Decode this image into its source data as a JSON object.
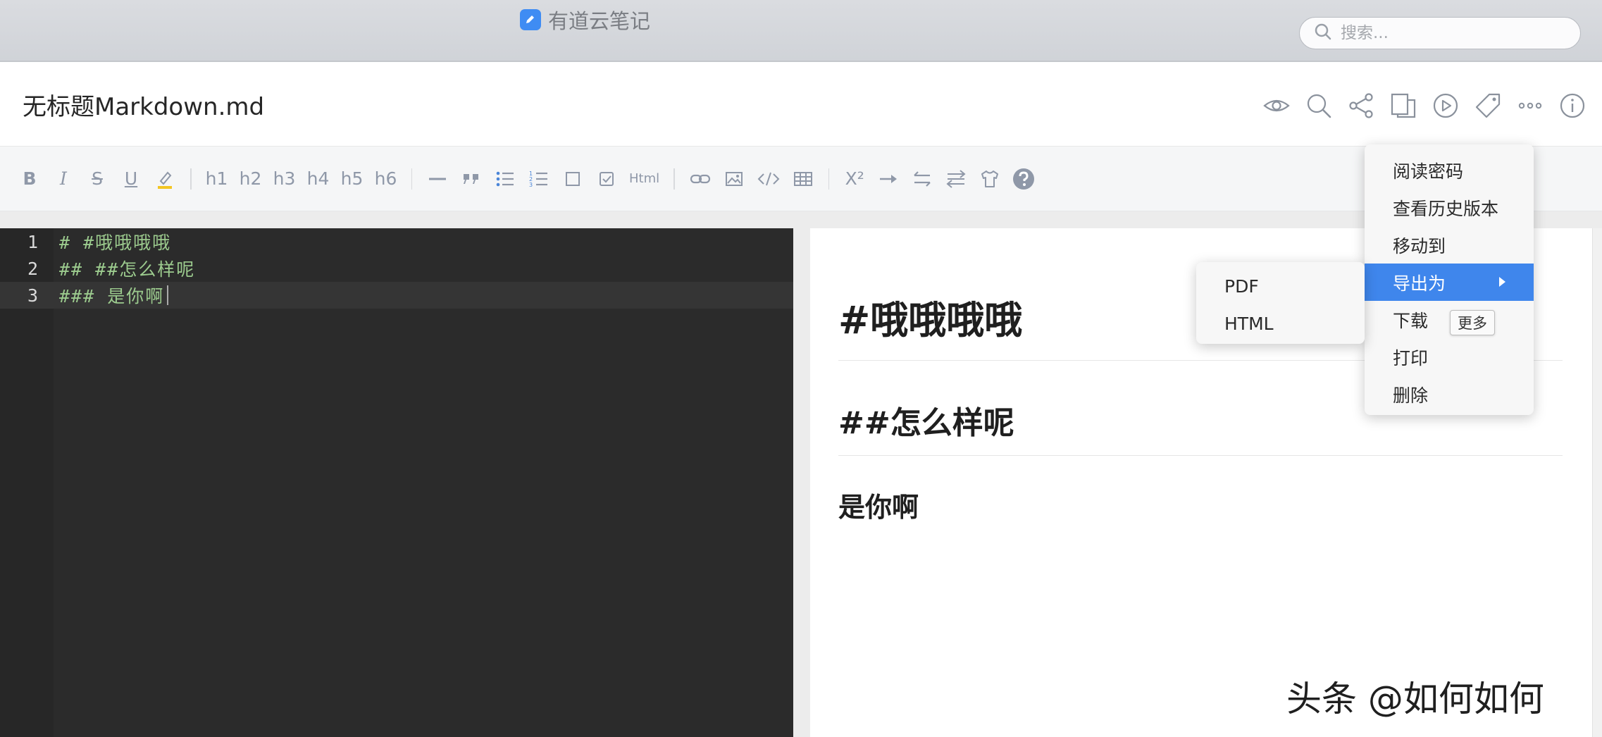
{
  "window": {
    "app_title": "有道云笔记",
    "search_placeholder": "搜索...",
    "search_value": ""
  },
  "document": {
    "title": "无标题Markdown.md",
    "header_icons": [
      "eye-icon",
      "search-icon",
      "share-icon",
      "copy-layout-icon",
      "play-icon",
      "tag-icon",
      "more-icon",
      "info-icon"
    ]
  },
  "toolbar": {
    "bold": "B",
    "italic": "I",
    "strike": "S",
    "underline": "U",
    "headings": [
      "h1",
      "h2",
      "h3",
      "h4",
      "h5",
      "h6"
    ],
    "html": "Html",
    "superscript": "X²"
  },
  "editor": {
    "lines": [
      {
        "number": "1",
        "text": "# #哦哦哦哦"
      },
      {
        "number": "2",
        "text": "## ##怎么样呢"
      },
      {
        "number": "3",
        "text": "### 是你啊"
      }
    ]
  },
  "preview": {
    "h1": "#哦哦哦哦",
    "h2": "##怎么样呢",
    "h3": "是你啊"
  },
  "context_menu": {
    "items": [
      "阅读密码",
      "查看历史版本",
      "移动到",
      "导出为",
      "下载",
      "打印",
      "删除"
    ],
    "active_index": 3,
    "submenu": [
      "PDF",
      "HTML"
    ],
    "tooltip": "更多"
  },
  "watermark": "头条 @如何如何",
  "colors": {
    "accent": "#3f86ec",
    "code_text": "#9ccb8e",
    "editor_bg": "#2b2b2b",
    "toolbar_icon": "#8f98a8"
  }
}
